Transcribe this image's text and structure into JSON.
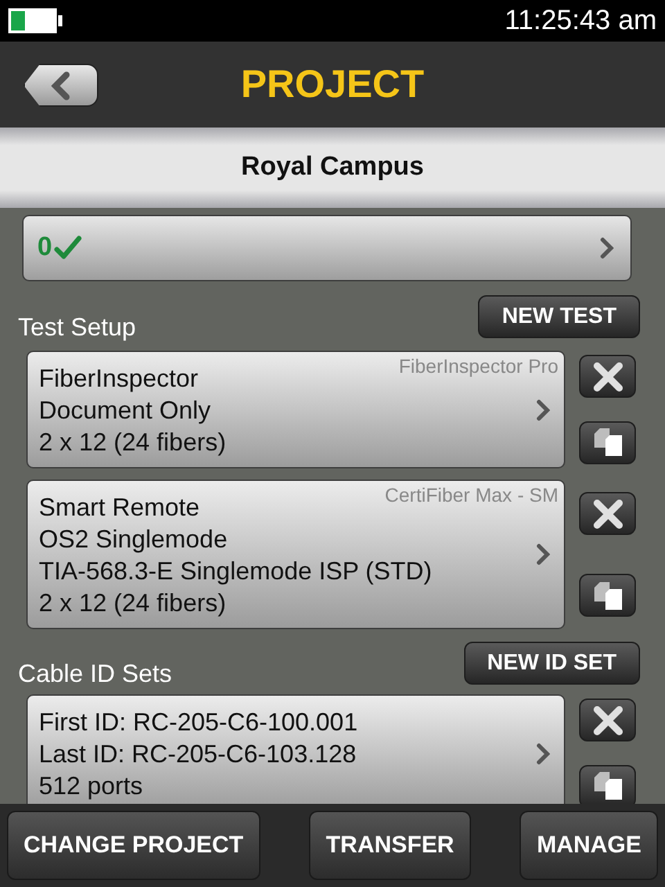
{
  "status_bar": {
    "time": "11:25:43 am"
  },
  "header": {
    "title": "PROJECT"
  },
  "project_name": "Royal Campus",
  "results": {
    "count": "0"
  },
  "test_setup": {
    "label": "Test Setup",
    "new_button": "NEW TEST",
    "items": [
      {
        "model": "FiberInspector Pro",
        "lines": [
          "FiberInspector",
          "Document Only",
          "2 x 12 (24 fibers)"
        ]
      },
      {
        "model": "CertiFiber Max - SM",
        "lines": [
          "Smart Remote",
          "OS2 Singlemode",
          "TIA-568.3-E Singlemode ISP (STD)",
          "2 x 12 (24 fibers)"
        ]
      }
    ]
  },
  "cable_id_sets": {
    "label": "Cable ID Sets",
    "new_button": "NEW ID SET",
    "items": [
      {
        "lines": [
          "First ID: RC-205-C6-100.001",
          "Last ID: RC-205-C6-103.128",
          "512 ports"
        ]
      }
    ]
  },
  "bottom_buttons": [
    "CHANGE PROJECT",
    "TRANSFER",
    "MANAGE"
  ]
}
